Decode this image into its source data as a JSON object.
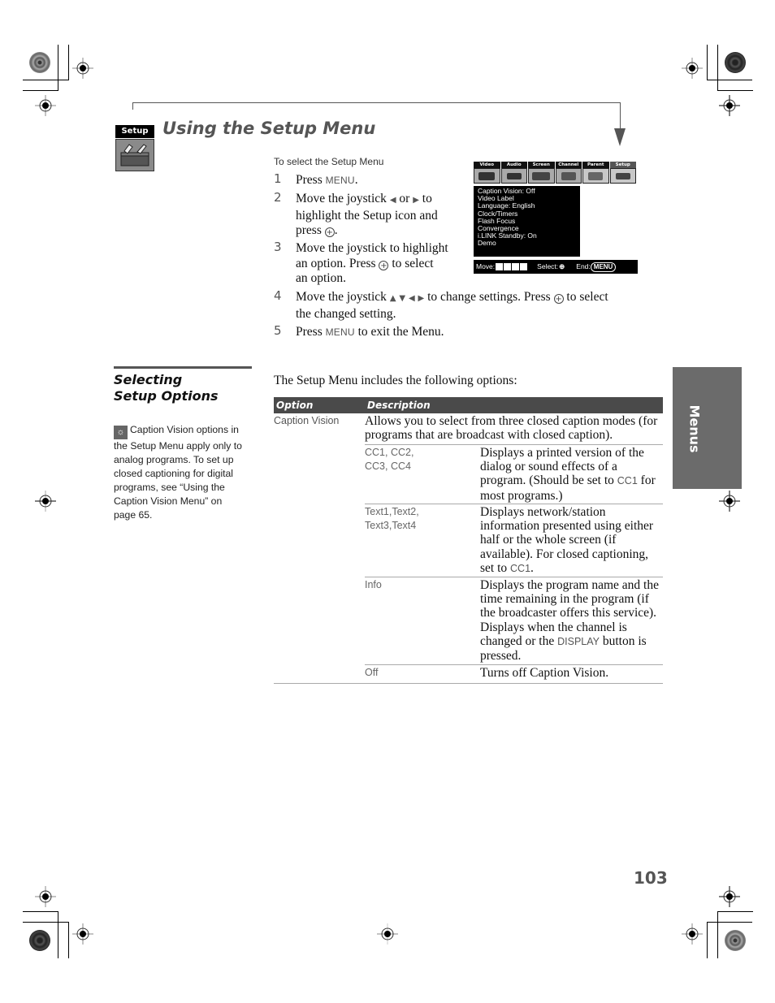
{
  "header": {
    "section_badge": "Setup",
    "title": "Using the Setup Menu"
  },
  "steps_section": {
    "subhead": "To select the Setup Menu",
    "steps": [
      {
        "num": "1",
        "parts": [
          "Press ",
          "MENU",
          "."
        ]
      },
      {
        "num": "2",
        "line1": "Move the joystick",
        "arrows": "◆ or ◆",
        "line1b": "to",
        "line2": "highlight the Setup icon and",
        "line3": "press",
        "line3b": "."
      },
      {
        "num": "3",
        "line1": "Move the joystick to highlight",
        "line2a": "an option. Press",
        "line2b": "to select",
        "line3": "an option."
      },
      {
        "num": "4",
        "line1a": "Move the joystick",
        "arrows": "▲ ▼ ◀ ▶",
        "line1b": "to change settings. Press",
        "line1c": "to select",
        "line2": "the changed setting."
      },
      {
        "num": "5",
        "a": "Press ",
        "key": "MENU",
        "b": " to exit the Menu."
      }
    ]
  },
  "tv_menu": {
    "tabs": [
      "Video",
      "Audio",
      "Screen",
      "Channel",
      "Parent",
      "Setup"
    ],
    "selected_tab": "Setup",
    "items": [
      "Caption Vision: Off",
      "Video Label",
      "Language: English",
      "Clock/Timers",
      "Flash Focus",
      "Convergence",
      "i.LINK Standby: On",
      "Demo"
    ],
    "footer": {
      "move": "Move:",
      "select": "Select:",
      "end": "End:",
      "end_key": "MENU"
    }
  },
  "sidebar": {
    "heading_line1": "Selecting",
    "heading_line2": "Setup Options",
    "tip_icon": "lightbulb-icon",
    "tip": "Caption Vision options in the Setup Menu apply only to analog programs. To set up closed captioning for digital programs, see “Using the Caption Vision Menu” on page 65."
  },
  "options_section": {
    "intro": "The Setup Menu includes the following options:",
    "table": {
      "headers": [
        "Option",
        "Description"
      ],
      "rows": [
        {
          "option": "Caption Vision",
          "description": "Allows you to select from three closed caption modes (for programs that are broadcast with closed caption).",
          "sub_options": [
            {
              "option": "CC1, CC2,\nCC3, CC4",
              "desc_a": "Displays a printed version of the dialog or sound effects of a program. (Should be set to ",
              "desc_key": "CC1",
              "desc_b": " for most programs.)"
            },
            {
              "option": "Text1,Text2,\nText3,Text4",
              "desc_a": "Displays network/station information presented using either half or the whole screen (if available). For closed captioning, set to ",
              "desc_key": "CC1",
              "desc_b": "."
            },
            {
              "option": "Info",
              "desc_a": "Displays the program name and the time remaining in the program (if the broadcaster offers this service). Displays when the channel is changed or the ",
              "desc_key": "DISPLAY",
              "desc_b": " button is pressed."
            },
            {
              "option": "Off",
              "desc_a": "Turns off Caption Vision.",
              "desc_key": "",
              "desc_b": ""
            }
          ]
        }
      ]
    }
  },
  "side_tab": {
    "label": "Menus"
  },
  "footer": {
    "page_number": "103"
  }
}
